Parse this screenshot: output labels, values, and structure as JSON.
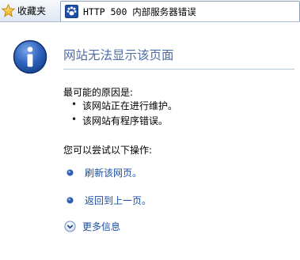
{
  "toolbar": {
    "favorites_label": "收藏夹",
    "favorites_icon": "star-icon",
    "tab_title": "HTTP 500 内部服务器错误",
    "tab_icon": "paw-icon"
  },
  "error": {
    "icon": "info-icon",
    "heading": "网站无法显示该页面",
    "causes_title": "最可能的原因是:",
    "causes": [
      "该网站正在进行维护。",
      "该网站有程序错误。"
    ],
    "actions_title": "您可以尝试以下操作:",
    "actions": [
      "刷新该网页。",
      "返回到上一页。"
    ],
    "more_info": "更多信息"
  },
  "colors": {
    "heading": "#4e6ea6",
    "link": "#1b4fa0",
    "icon_blue": "#1e4fa6"
  }
}
